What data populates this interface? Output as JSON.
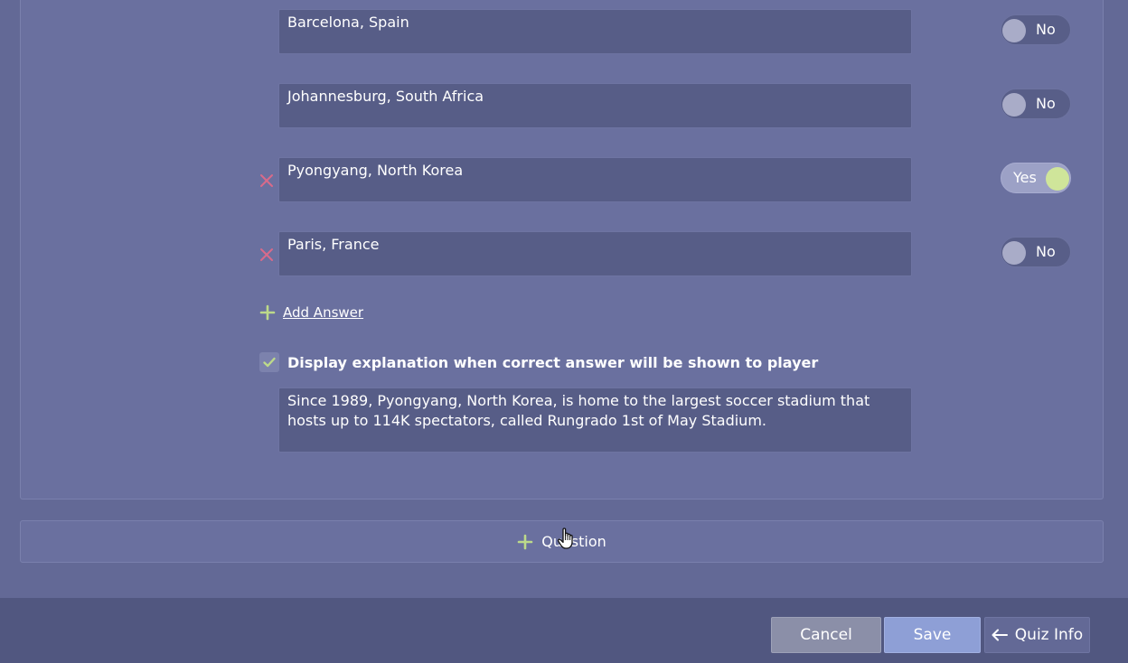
{
  "answers": [
    {
      "text": "Barcelona, Spain",
      "toggle_label": "No",
      "correct": false,
      "removable": false
    },
    {
      "text": "Johannesburg, South Africa",
      "toggle_label": "No",
      "correct": false,
      "removable": false
    },
    {
      "text": "Pyongyang, North Korea",
      "toggle_label": "Yes",
      "correct": true,
      "removable": true
    },
    {
      "text": "Paris, France",
      "toggle_label": "No",
      "correct": false,
      "removable": true
    }
  ],
  "add_answer_label": "Add Answer",
  "explanation": {
    "checked": true,
    "checkbox_label": "Display explanation when correct answer will be shown to player",
    "text": "Since 1989, Pyongyang, North Korea, is home to the largest soccer stadium that hosts up to 114K spectators, called Rungrado 1st of May Stadium."
  },
  "add_question_label": "Question",
  "footer": {
    "cancel_label": "Cancel",
    "save_label": "Save",
    "quiz_info_label": "Quiz Info"
  },
  "colors": {
    "toggle_on_knob": "#cfe59a",
    "remove_icon": "#d96a8a",
    "plus_icon": "#bcd98a",
    "save_button": "#8e9fd6"
  },
  "icons": {
    "remove": "close-icon",
    "add": "plus-icon",
    "check": "check-icon",
    "back": "arrow-left-icon",
    "cursor": "hand-pointer-icon"
  }
}
